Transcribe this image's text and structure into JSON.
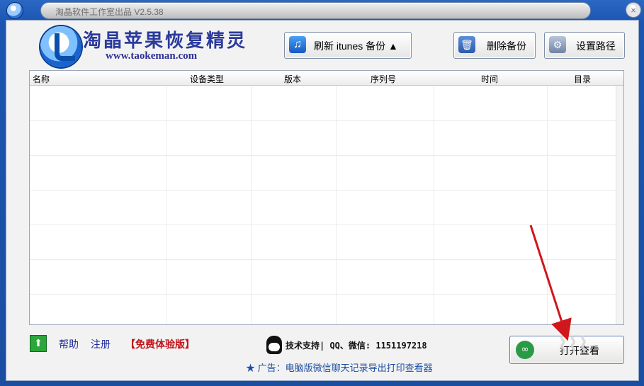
{
  "window": {
    "title": "淘晶软件工作室出品 V2.5.38"
  },
  "header": {
    "logo_title": "淘晶苹果恢复精灵",
    "logo_url": "www.taokeman.com",
    "buttons": {
      "refresh": "刷新 itunes 备份 ▲",
      "delete": "删除备份",
      "set_path": "设置路径"
    }
  },
  "table": {
    "columns": [
      "名称",
      "设备类型",
      "版本",
      "序列号",
      "时间",
      "目录"
    ],
    "rows": []
  },
  "footer": {
    "help": "帮助",
    "register": "注册",
    "trial": "【免费体验版】",
    "support": "技术支持| QQ、微信: 1151197218",
    "ad": "★ 广告：电脑版微信聊天记录导出打印查看器",
    "open_button": "打开查看"
  },
  "colors": {
    "titlebar": "#1b55b0",
    "accent_red": "#c0141b",
    "arrow_red": "#d0171c"
  }
}
